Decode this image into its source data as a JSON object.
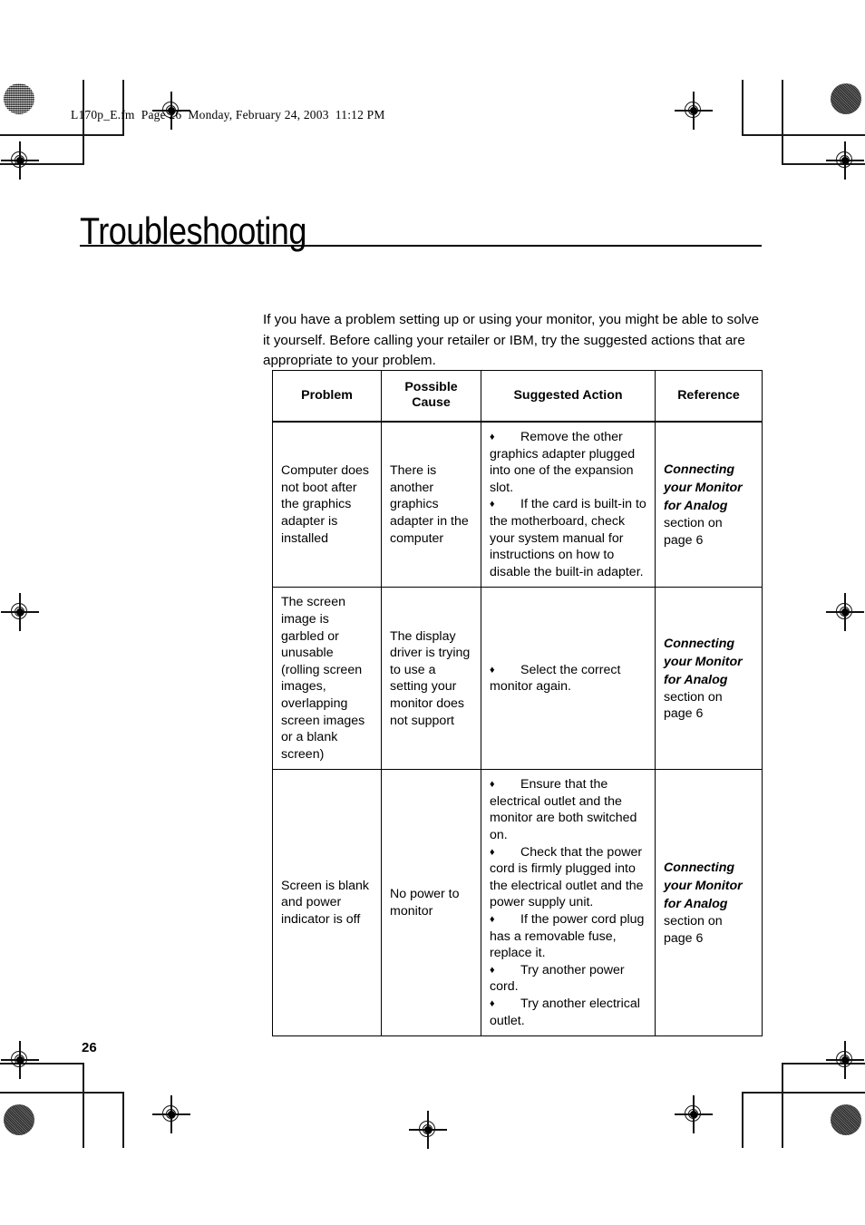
{
  "page": {
    "fm_header": "L170p_E.fm  Page 26  Monday, February 24, 2003  11:12 PM",
    "title": "Troubleshooting",
    "folio": "26",
    "intro": "If you have a problem setting up or using your monitor, you might be able to solve it yourself. Before calling your retailer or IBM, try the suggested actions that are appropriate to your problem."
  },
  "table": {
    "headers": {
      "problem": "Problem",
      "cause": "Possible\nCause",
      "action": "Suggested Action",
      "reference": "Reference"
    },
    "bullet_glyph": "♦",
    "rows": [
      {
        "problem": "Computer does not boot after the graphics adapter is installed",
        "cause": "There is another graphics adapter in the computer",
        "actions": [
          "Remove the other graphics adapter plugged into one of the expansion slot.",
          "If the card is built-in to the motherboard, check your system manual for instructions on how to disable the built-in adapter."
        ],
        "ref_title": "Connecting your Monitor for Analog",
        "ref_sub": "section on page 6"
      },
      {
        "problem": "The screen image is garbled or unusable (rolling screen images, overlapping screen images or a blank screen)",
        "cause": "The display driver is trying to use a setting your monitor does not support",
        "actions": [
          "Select the correct monitor again."
        ],
        "ref_title": "Connecting your Monitor for Analog",
        "ref_sub": "section on page 6"
      },
      {
        "problem": "Screen is blank and power indicator is off",
        "cause": "No power to monitor",
        "actions": [
          "Ensure that the electrical outlet and the monitor are both switched on.",
          "Check that the power cord is firmly plugged into the electrical outlet and the power supply unit.",
          "If the power cord plug has a removable fuse, replace it.",
          "Try another power cord.",
          "Try another electrical outlet."
        ],
        "ref_title": "Connecting your Monitor for Analog",
        "ref_sub": "section on page 6"
      }
    ]
  },
  "print_marks": {
    "registration_icon": "registration-target-icon",
    "density_icon": "density-patch-icon",
    "crop_icon": "crop-mark-icon"
  }
}
